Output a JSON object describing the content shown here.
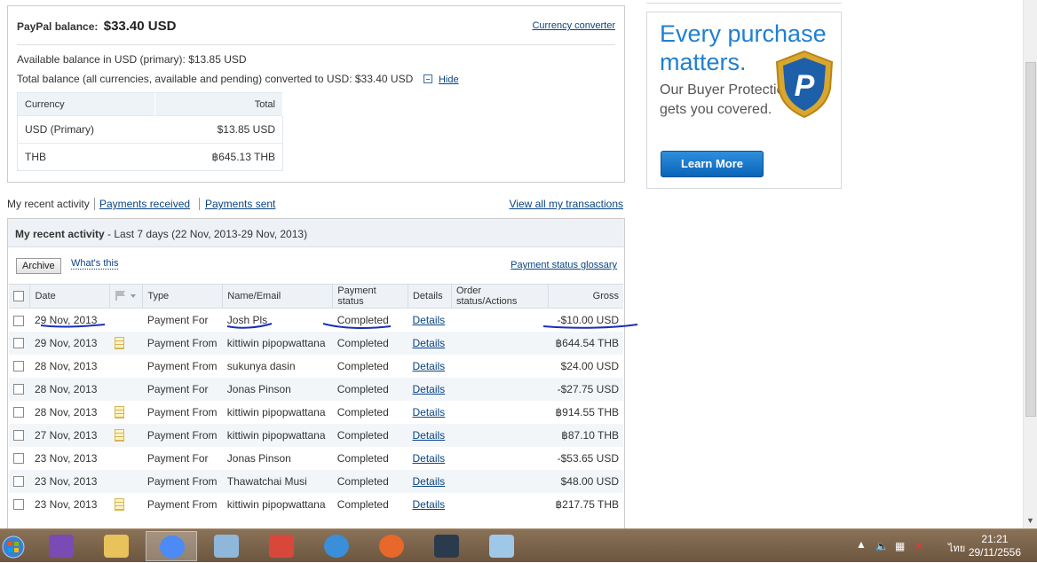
{
  "balance": {
    "label": "PayPal balance:",
    "value": "$33.40 USD",
    "currency_converter": "Currency converter",
    "available_line": "Available balance in USD (primary): $13.85 USD",
    "total_line": "Total balance (all currencies, available and pending) converted to USD: $33.40 USD",
    "hide": "Hide",
    "table": {
      "headers": [
        "Currency",
        "Total"
      ],
      "rows": [
        {
          "currency": "USD (Primary)",
          "total": "$13.85 USD"
        },
        {
          "currency": "THB",
          "total": "฿645.13 THB"
        }
      ]
    }
  },
  "promo": {
    "title": "Every purchase matters.",
    "subtitle": "Our Buyer Protection gets you covered.",
    "button": "Learn More",
    "shield_letter": "P"
  },
  "tabs": {
    "recent": "My recent activity",
    "received": "Payments received",
    "sent": "Payments sent",
    "view_all": "View all my transactions"
  },
  "activity": {
    "title": "My recent activity",
    "range": " - Last 7 days (22 Nov, 2013-29 Nov, 2013)",
    "archive": "Archive",
    "whats_this": "What's this",
    "glossary": "Payment status glossary",
    "columns": [
      "Date",
      "Type",
      "Name/Email",
      "Payment status",
      "Details",
      "Order status/Actions",
      "Gross"
    ],
    "rows": [
      {
        "date": "29 Nov, 2013",
        "note": false,
        "type": "Payment For",
        "name": "Josh Pls",
        "status": "Completed",
        "details": "Details",
        "gross": "-$10.00 USD"
      },
      {
        "date": "29 Nov, 2013",
        "note": true,
        "type": "Payment From",
        "name": "kittiwin pipopwattana",
        "status": "Completed",
        "details": "Details",
        "gross": "฿644.54 THB"
      },
      {
        "date": "28 Nov, 2013",
        "note": false,
        "type": "Payment From",
        "name": "sukunya dasin",
        "status": "Completed",
        "details": "Details",
        "gross": "$24.00 USD"
      },
      {
        "date": "28 Nov, 2013",
        "note": false,
        "type": "Payment For",
        "name": "Jonas Pinson",
        "status": "Completed",
        "details": "Details",
        "gross": "-$27.75 USD"
      },
      {
        "date": "28 Nov, 2013",
        "note": true,
        "type": "Payment From",
        "name": "kittiwin pipopwattana",
        "status": "Completed",
        "details": "Details",
        "gross": "฿914.55 THB"
      },
      {
        "date": "27 Nov, 2013",
        "note": true,
        "type": "Payment From",
        "name": "kittiwin pipopwattana",
        "status": "Completed",
        "details": "Details",
        "gross": "฿87.10 THB"
      },
      {
        "date": "23 Nov, 2013",
        "note": false,
        "type": "Payment For",
        "name": "Jonas Pinson",
        "status": "Completed",
        "details": "Details",
        "gross": "-$53.65 USD"
      },
      {
        "date": "23 Nov, 2013",
        "note": false,
        "type": "Payment From",
        "name": "Thawatchai Musi",
        "status": "Completed",
        "details": "Details",
        "gross": "$48.00 USD"
      },
      {
        "date": "23 Nov, 2013",
        "note": true,
        "type": "Payment From",
        "name": "kittiwin pipopwattana",
        "status": "Completed",
        "details": "Details",
        "gross": "฿217.75 THB"
      }
    ]
  },
  "taskbar": {
    "apps": [
      "visual-studio-icon",
      "file-explorer-icon",
      "chrome-icon",
      "calculator-icon",
      "snipping-tool-icon",
      "thunderbird-icon",
      "firefox-icon",
      "steam-icon",
      "notepad-icon"
    ],
    "active_index": 2,
    "language": "ไทย",
    "time": "21:21",
    "date": "29/11/2556"
  },
  "colors": {
    "link": "#084482",
    "promo_blue": "#1f7fd0",
    "button_blue": "#0a64b8",
    "annotation_ink": "#1a2fb8",
    "taskbar": "#7a6149"
  }
}
